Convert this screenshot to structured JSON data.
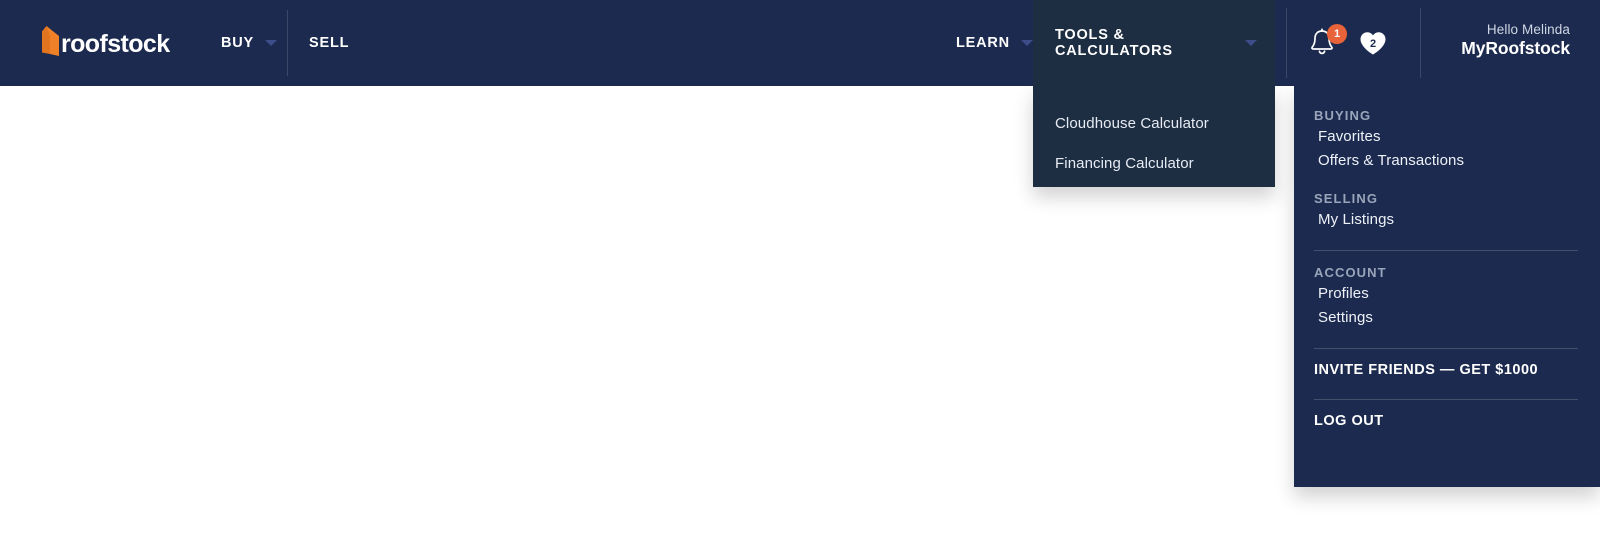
{
  "colors": {
    "header_bg": "#1b2a4e",
    "panel_dark_bg": "#1d2d42",
    "accent_orange": "#e8623a",
    "chevron": "#3c4d8a",
    "muted_text": "#9aa5bb"
  },
  "header": {
    "logo": {
      "icon": "roofstock-arrow-logo-icon",
      "text": "roofstock"
    },
    "nav": [
      {
        "label": "BUY",
        "has_chevron": true,
        "active": false
      },
      {
        "label": "SELL",
        "has_chevron": false,
        "active": false
      },
      {
        "label": "LEARN",
        "has_chevron": true,
        "active": false
      },
      {
        "label": "TOOLS & CALCULATORS",
        "has_chevron": true,
        "active": true
      }
    ],
    "icons": {
      "bell": {
        "name": "bell-icon",
        "badge": "1"
      },
      "heart": {
        "name": "heart-icon",
        "count": "2"
      }
    },
    "user": {
      "greeting": "Hello Melinda",
      "account_label": "MyRoofstock"
    }
  },
  "tools_dropdown": {
    "open": true,
    "items": [
      {
        "label": "Cloudhouse Calculator"
      },
      {
        "label": "Financing Calculator"
      }
    ]
  },
  "account_dropdown": {
    "open": true,
    "sections": [
      {
        "heading": "BUYING",
        "items": [
          {
            "label": "Favorites"
          },
          {
            "label": "Offers & Transactions"
          }
        ]
      },
      {
        "heading": "SELLING",
        "items": [
          {
            "label": "My Listings"
          }
        ]
      },
      {
        "heading": "ACCOUNT",
        "items": [
          {
            "label": "Profiles"
          },
          {
            "label": "Settings"
          }
        ]
      }
    ],
    "invite_label": "INVITE FRIENDS — GET $1000",
    "logout_label": "LOG OUT"
  }
}
